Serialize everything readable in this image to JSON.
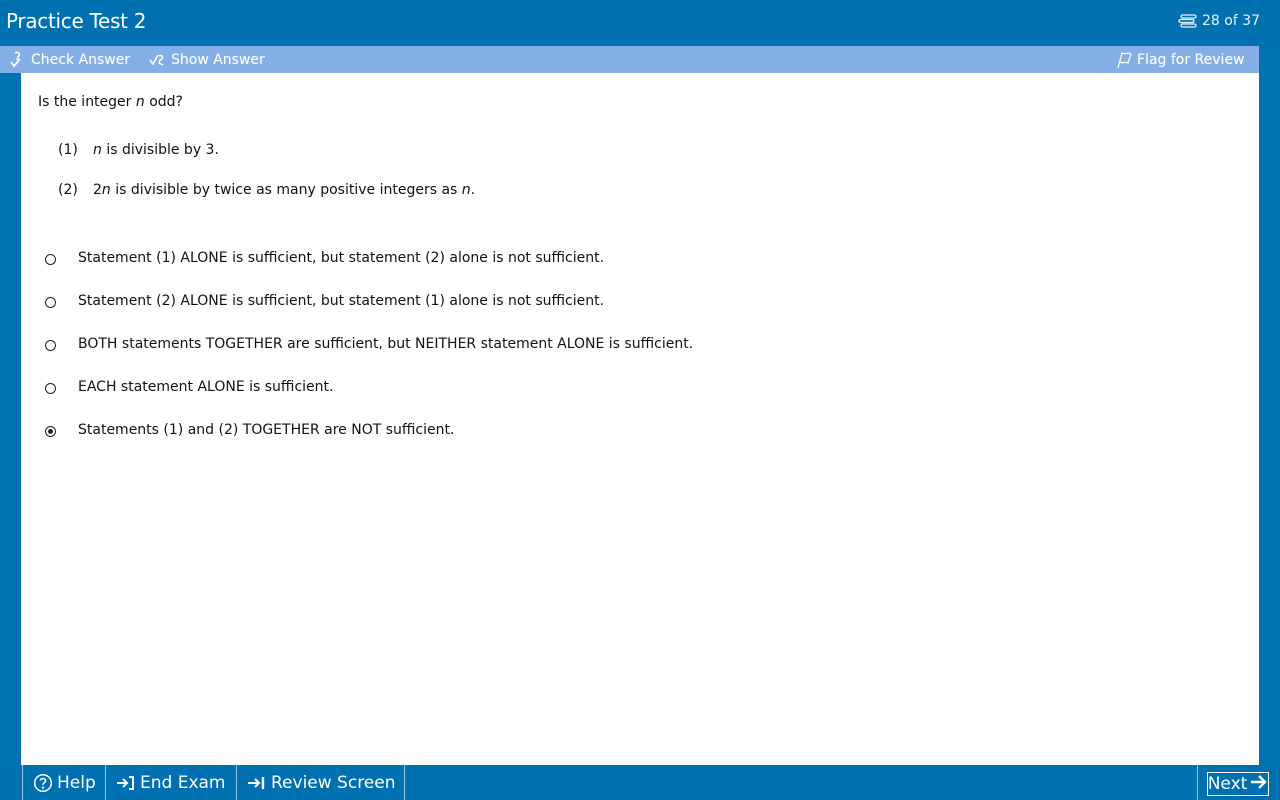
{
  "window": {
    "title": "Practice Test 2",
    "progress": "28 of 37"
  },
  "toolbar": {
    "check_answer": "Check Answer",
    "show_answer": "Show Answer",
    "flag_for_review": "Flag for Review"
  },
  "question": {
    "stem_before": "Is the integer ",
    "stem_var": "n",
    "stem_after": " odd?",
    "statements": [
      {
        "num": "(1)",
        "var": "n",
        "text": " is divisible by 3.",
        "prefix": "",
        "suffix_var": "",
        "end": ""
      },
      {
        "num": "(2)",
        "prefix": "2",
        "var": "n",
        "text": " is divisible by twice as many positive integers as ",
        "suffix_var": "n",
        "end": "."
      }
    ],
    "options": [
      {
        "label": "Statement (1) ALONE is sufficient, but statement (2) alone is not sufficient.",
        "selected": false
      },
      {
        "label": "Statement (2) ALONE is sufficient, but statement (1) alone is not sufficient.",
        "selected": false
      },
      {
        "label": "BOTH statements TOGETHER are sufficient, but NEITHER statement ALONE is sufficient.",
        "selected": false
      },
      {
        "label": "EACH statement ALONE is sufficient.",
        "selected": false
      },
      {
        "label": "Statements (1) and (2) TOGETHER are NOT sufficient.",
        "selected": true
      }
    ]
  },
  "bottombar": {
    "help": "Help",
    "end_exam": "End Exam",
    "review_screen": "Review Screen",
    "next": "Next"
  },
  "colors": {
    "frame_blue": "#0071b0",
    "toolbar_blue": "#84aee6",
    "content_bg": "#ffffff"
  },
  "icons": [
    "stack-icon",
    "check-answer-icon",
    "show-answer-icon",
    "flag-icon",
    "help-icon",
    "end-exam-icon",
    "review-screen-icon",
    "next-arrow-icon"
  ]
}
